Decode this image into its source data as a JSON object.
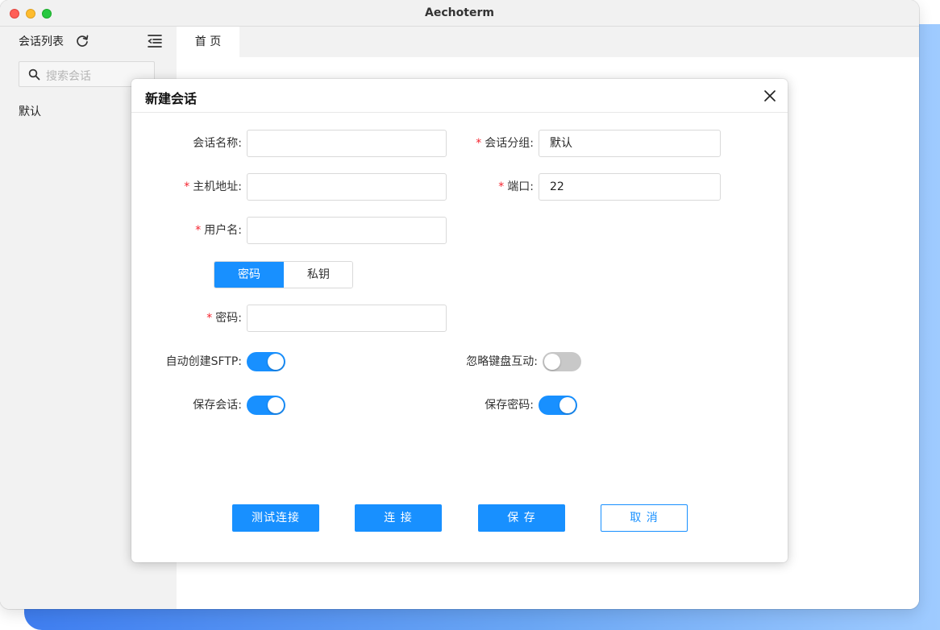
{
  "window": {
    "title": "Aechoterm"
  },
  "sidebar": {
    "title": "会话列表",
    "search": {
      "placeholder": "搜索会话"
    },
    "groups": [
      "默认"
    ]
  },
  "tabs": [
    {
      "label": "首 页",
      "active": true
    }
  ],
  "dialog": {
    "title": "新建会话",
    "fields": {
      "session_name": {
        "label": "会话名称:",
        "required": false,
        "value": ""
      },
      "session_group": {
        "label": "会话分组:",
        "required": true,
        "value": "默认"
      },
      "host": {
        "label": "主机地址:",
        "required": true,
        "value": ""
      },
      "port": {
        "label": "端口:",
        "required": true,
        "value": "22"
      },
      "username": {
        "label": "用户名:",
        "required": true,
        "value": ""
      },
      "password": {
        "label": "密码:",
        "required": true,
        "value": ""
      }
    },
    "auth_mode": {
      "options": [
        "密码",
        "私钥"
      ],
      "selected": "密码"
    },
    "toggles": {
      "auto_sftp": {
        "label": "自动创建SFTP:",
        "on": true
      },
      "ignore_keyboard": {
        "label": "忽略键盘互动:",
        "on": false
      },
      "save_session": {
        "label": "保存会话:",
        "on": true
      },
      "save_password": {
        "label": "保存密码:",
        "on": true
      }
    },
    "buttons": {
      "test": "测试连接",
      "connect": "连 接",
      "save": "保 存",
      "cancel": "取 消"
    }
  },
  "colors": {
    "accent": "#1890ff",
    "required": "#f5222d",
    "toggle_off": "#c8c8c8"
  }
}
